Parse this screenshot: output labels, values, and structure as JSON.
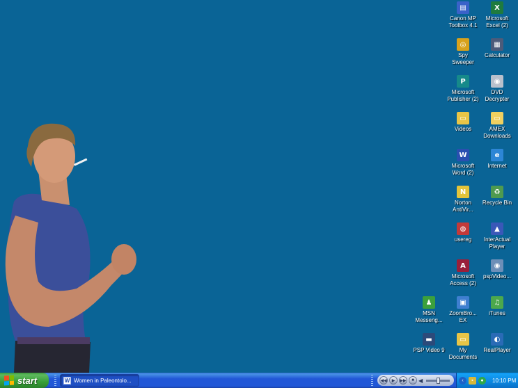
{
  "desktop": {
    "background_color": "#0a6496",
    "icons": [
      {
        "label": "Canon MP\nToolbox 4.1",
        "icon": "canon-toolbox-icon",
        "color": "#3a62c9",
        "glyph": "▤"
      },
      {
        "label": "Microsoft\nExcel (2)",
        "icon": "excel-icon",
        "color": "#1e7b3e",
        "glyph": "X"
      },
      {
        "label": "Spy\nSweeper",
        "icon": "spy-sweeper-icon",
        "color": "#d8a21c",
        "glyph": "◎"
      },
      {
        "label": "Calculator",
        "icon": "calculator-icon",
        "color": "#4d5b7a",
        "glyph": "▦"
      },
      {
        "label": "Microsoft\nPublisher (2)",
        "icon": "publisher-icon",
        "color": "#168a8a",
        "glyph": "P"
      },
      {
        "label": "DVD\nDecrypter",
        "icon": "dvd-decrypter-icon",
        "color": "#b9c0cc",
        "glyph": "◉"
      },
      {
        "label": "Videos",
        "icon": "videos-folder-icon",
        "color": "#e8c547",
        "glyph": "▭"
      },
      {
        "label": "AMEX\nDownloads",
        "icon": "amex-downloads-folder-icon",
        "color": "#f0d060",
        "glyph": "▭"
      },
      {
        "label": "Microsoft\nWord (2)",
        "icon": "word-icon",
        "color": "#2a4fb0",
        "glyph": "W"
      },
      {
        "label": "Internet",
        "icon": "internet-explorer-icon",
        "color": "#2d86d6",
        "glyph": "e"
      },
      {
        "label": "Norton\nAntiVir...",
        "icon": "norton-antivirus-icon",
        "color": "#e3c43a",
        "glyph": "N"
      },
      {
        "label": "Recycle Bin",
        "icon": "recycle-bin-icon",
        "color": "#4f9a4f",
        "glyph": "♻"
      },
      {
        "label": "usereg",
        "icon": "usereg-icon",
        "color": "#c23a3a",
        "glyph": "◍"
      },
      {
        "label": "InterActual\nPlayer",
        "icon": "interactual-player-icon",
        "color": "#3a58b8",
        "glyph": "▲"
      },
      {
        "label": "Microsoft\nAccess (2)",
        "icon": "access-icon",
        "color": "#9a1f3a",
        "glyph": "A"
      },
      {
        "label": "pspVideo...",
        "icon": "psp-video-shortcut-icon",
        "color": "#6d8fb8",
        "glyph": "◉"
      },
      {
        "label": "MSN\nMesseng...",
        "icon": "msn-messenger-icon",
        "color": "#3ca03c",
        "glyph": "♟"
      },
      {
        "label": "ZoomBro...\nEX",
        "icon": "zoombrowser-icon",
        "color": "#3f7fd0",
        "glyph": "▣"
      },
      {
        "label": "iTunes",
        "icon": "itunes-icon",
        "color": "#4ca84c",
        "glyph": "♫"
      },
      {
        "label": "PSP Video 9",
        "icon": "psp-video-9-icon",
        "color": "#2c4a7a",
        "glyph": "▬"
      },
      {
        "label": "My\nDocuments",
        "icon": "my-documents-icon",
        "color": "#e8c547",
        "glyph": "▭"
      },
      {
        "label": "RealPlayer",
        "icon": "realplayer-icon",
        "color": "#2a6bb6",
        "glyph": "◐"
      }
    ]
  },
  "taskbar": {
    "start_label": "start",
    "active_task": "Women in Paleontolo...",
    "clock": "10:10 PM",
    "media_controls": [
      "rewind",
      "play",
      "forward",
      "stop"
    ],
    "volume_fraction": 0.45
  }
}
